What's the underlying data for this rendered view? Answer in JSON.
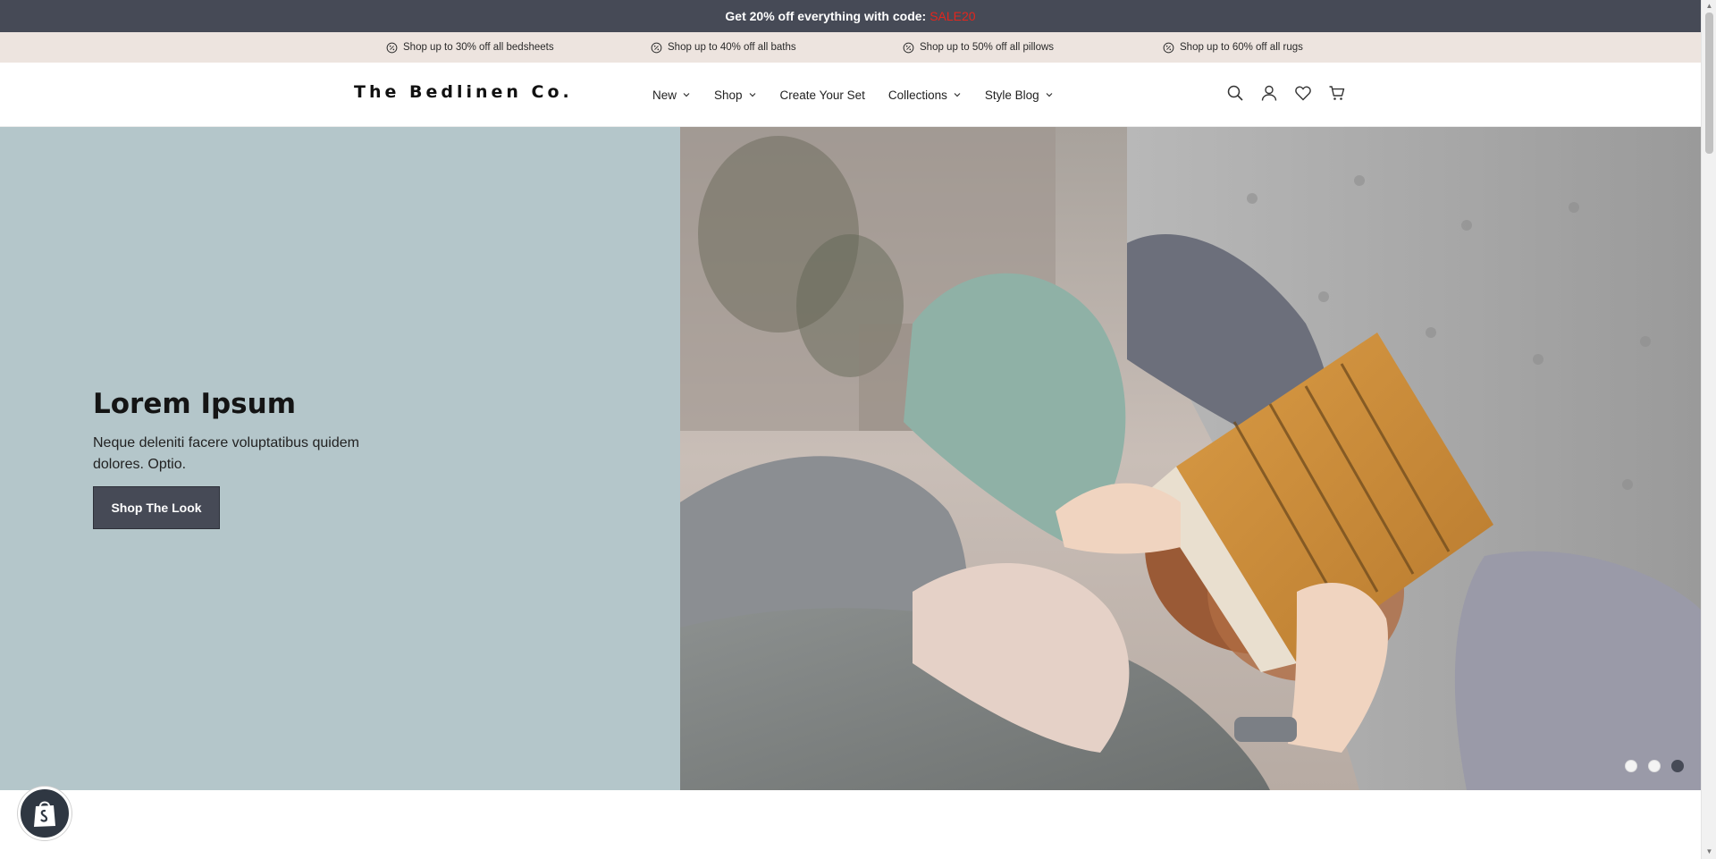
{
  "announcement": {
    "text": "Get 20% off everything with code:",
    "code": "SALE20"
  },
  "promos": [
    {
      "icon": "discount-badge-icon",
      "label": "Shop up to 30% off all bedsheets"
    },
    {
      "icon": "discount-badge-icon",
      "label": "Shop up to 40% off all baths"
    },
    {
      "icon": "discount-badge-icon",
      "label": "Shop up to 50% off all pillows"
    },
    {
      "icon": "discount-badge-icon",
      "label": "Shop up to 60% off all rugs"
    }
  ],
  "header": {
    "logo": "The Bedlinen Co.",
    "nav": [
      {
        "label": "New",
        "dropdown": true
      },
      {
        "label": "Shop",
        "dropdown": true
      },
      {
        "label": "Create Your Set",
        "dropdown": false
      },
      {
        "label": "Collections",
        "dropdown": true
      },
      {
        "label": "Style Blog",
        "dropdown": true
      }
    ],
    "icons": [
      "search-icon",
      "account-icon",
      "wishlist-heart-icon",
      "cart-icon"
    ]
  },
  "hero": {
    "title": "Lorem Ipsum",
    "description": "Neque deleniti facere voluptatibus quidem dolores. Optio.",
    "button_label": "Shop The Look",
    "background_color": "#b4c6ca",
    "slides": 3,
    "active_slide": 3
  },
  "colors": {
    "announcement_bg": "#464a56",
    "promo_bg": "#ede4df",
    "code_color": "#e4251c",
    "button_bg": "#464a56"
  },
  "badge": {
    "icon": "shopify-bag-icon"
  }
}
